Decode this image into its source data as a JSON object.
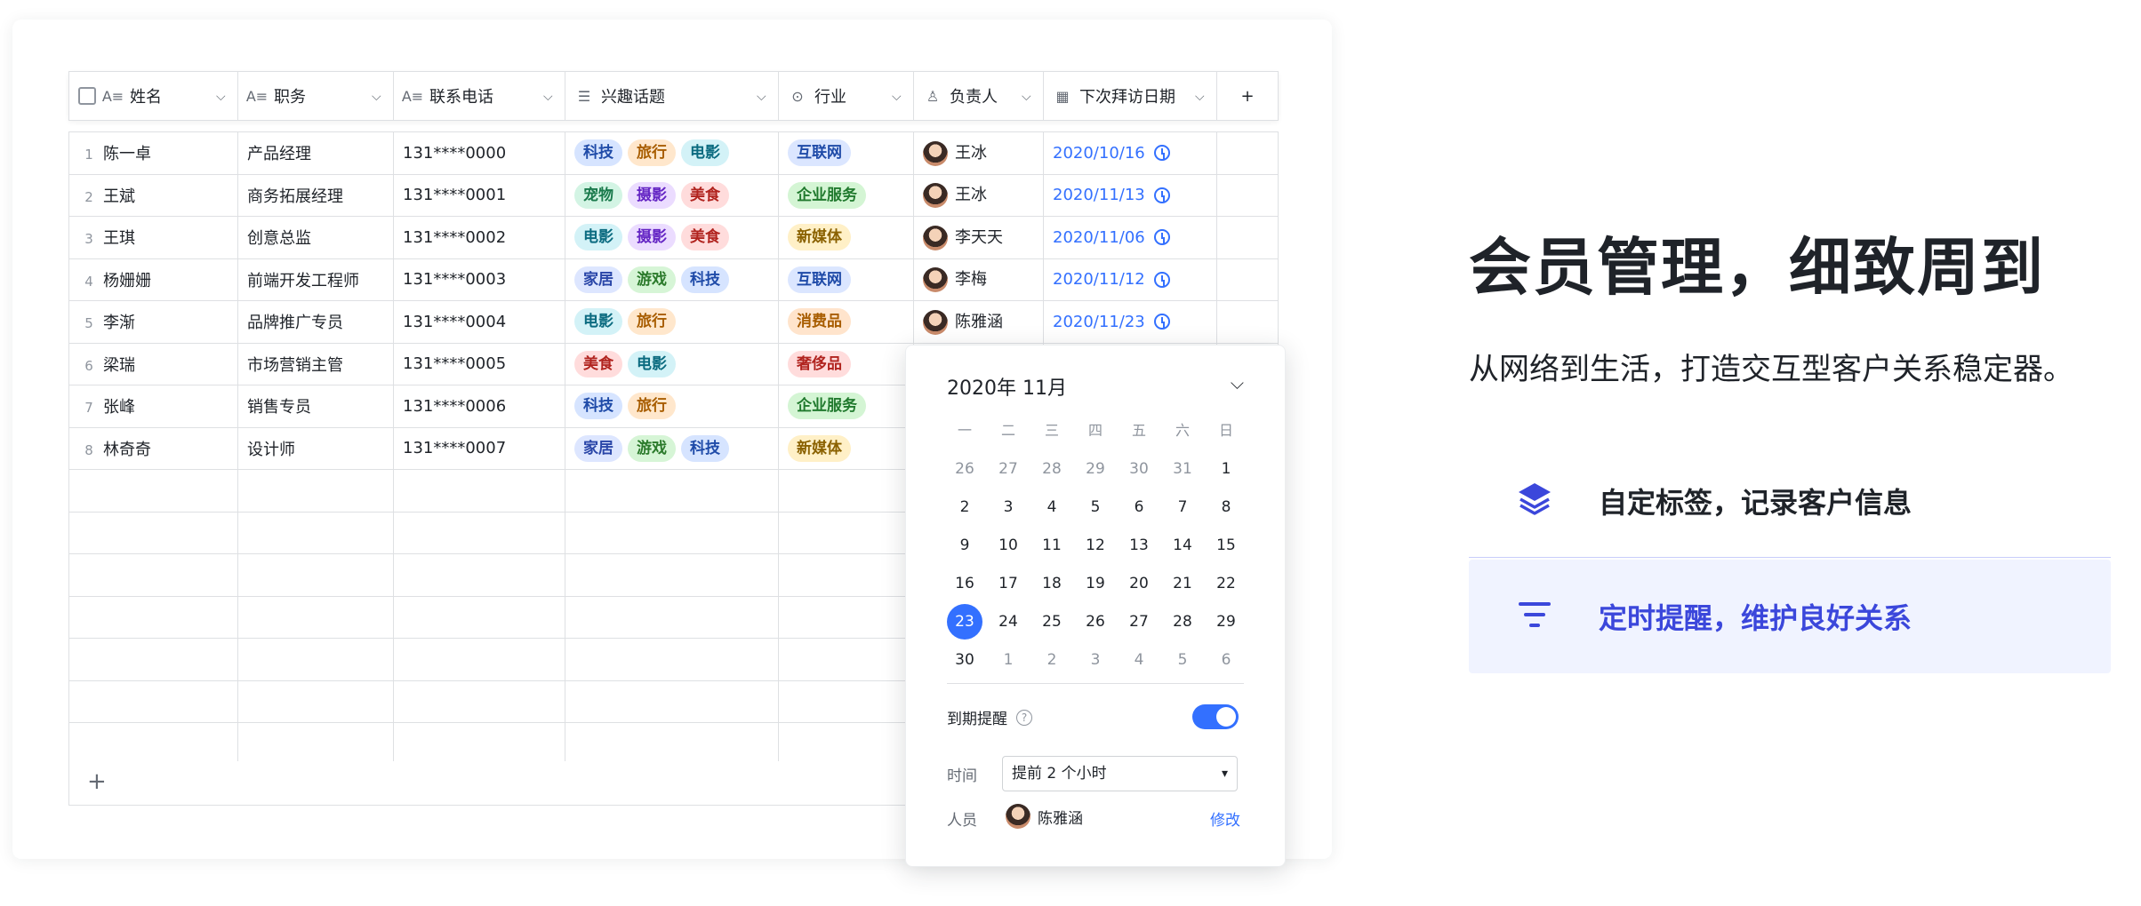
{
  "table": {
    "columns": [
      "姓名",
      "职务",
      "联系电话",
      "兴趣话题",
      "行业",
      "负责人",
      "下次拜访日期"
    ],
    "rows": [
      {
        "idx": "1",
        "name": "陈一卓",
        "title": "产品经理",
        "phone": "131****0000",
        "tags": [
          "科技",
          "旅行",
          "电影"
        ],
        "industry": "互联网",
        "owner": "王冰",
        "date": "2020/10/16"
      },
      {
        "idx": "2",
        "name": "王斌",
        "title": "商务拓展经理",
        "phone": "131****0001",
        "tags": [
          "宠物",
          "摄影",
          "美食"
        ],
        "industry": "企业服务",
        "owner": "王冰",
        "date": "2020/11/13"
      },
      {
        "idx": "3",
        "name": "王琪",
        "title": "创意总监",
        "phone": "131****0002",
        "tags": [
          "电影",
          "摄影",
          "美食"
        ],
        "industry": "新媒体",
        "owner": "李天天",
        "date": "2020/11/06"
      },
      {
        "idx": "4",
        "name": "杨姗姗",
        "title": "前端开发工程师",
        "phone": "131****0003",
        "tags": [
          "家居",
          "游戏",
          "科技"
        ],
        "industry": "互联网",
        "owner": "李梅",
        "date": "2020/11/12"
      },
      {
        "idx": "5",
        "name": "李渐",
        "title": "品牌推广专员",
        "phone": "131****0004",
        "tags": [
          "电影",
          "旅行"
        ],
        "industry": "消费品",
        "owner": "陈雅涵",
        "date": "2020/11/23"
      },
      {
        "idx": "6",
        "name": "梁瑞",
        "title": "市场营销主管",
        "phone": "131****0005",
        "tags": [
          "美食",
          "电影"
        ],
        "industry": "奢侈品",
        "owner": "",
        "date": ""
      },
      {
        "idx": "7",
        "name": "张峰",
        "title": "销售专员",
        "phone": "131****0006",
        "tags": [
          "科技",
          "旅行"
        ],
        "industry": "企业服务",
        "owner": "",
        "date": ""
      },
      {
        "idx": "8",
        "name": "林奇奇",
        "title": "设计师",
        "phone": "131****0007",
        "tags": [
          "家居",
          "游戏",
          "科技"
        ],
        "industry": "新媒体",
        "owner": "",
        "date": ""
      }
    ],
    "add_row": "+"
  },
  "tag_colors": {
    "科技": [
      "#d6e4ff",
      "#1f4ba8"
    ],
    "旅行": [
      "#ffe7cc",
      "#a85d00"
    ],
    "电影": [
      "#d3f2f7",
      "#0b6b80"
    ],
    "宠物": [
      "#d3f4e4",
      "#1a7a4c"
    ],
    "摄影": [
      "#ebdcff",
      "#6425c4"
    ],
    "美食": [
      "#ffdcdc",
      "#b1241f"
    ],
    "家居": [
      "#dde6ff",
      "#2a46a8"
    ],
    "游戏": [
      "#d6f5d6",
      "#2b7a2b"
    ],
    "互联网": [
      "#dbe6ff",
      "#1f4ba8"
    ],
    "企业服务": [
      "#d4f5d4",
      "#217a2e"
    ],
    "新媒体": [
      "#fff0c7",
      "#8a6100"
    ],
    "消费品": [
      "#ffe4cc",
      "#a85d00"
    ],
    "奢侈品": [
      "#ffdcdc",
      "#b1241f"
    ]
  },
  "datepicker": {
    "title": "2020年 11月",
    "weekdays": [
      "一",
      "二",
      "三",
      "四",
      "五",
      "六",
      "日"
    ],
    "weeks": [
      [
        "26",
        "27",
        "28",
        "29",
        "30",
        "31",
        "1"
      ],
      [
        "2",
        "3",
        "4",
        "5",
        "6",
        "7",
        "8"
      ],
      [
        "9",
        "10",
        "11",
        "12",
        "13",
        "14",
        "15"
      ],
      [
        "16",
        "17",
        "18",
        "19",
        "20",
        "21",
        "22"
      ],
      [
        "23",
        "24",
        "25",
        "26",
        "27",
        "28",
        "29"
      ],
      [
        "30",
        "1",
        "2",
        "3",
        "4",
        "5",
        "6"
      ]
    ],
    "selected": "23",
    "remind_label": "到期提醒",
    "remind_on": true,
    "time_label": "时间",
    "time_value": "提前 2 个小时",
    "person_label": "人员",
    "person_value": "陈雅涵",
    "modify_label": "修改"
  },
  "hero": {
    "title": "会员管理，细致周到",
    "subtitle": "从网络到生活，打造交互型客户关系稳定器。",
    "features": [
      {
        "label": "自定标签，记录客户信息",
        "icon": "layers-icon"
      },
      {
        "label": "定时提醒，维护良好关系",
        "icon": "filter-lines-icon"
      }
    ]
  },
  "accent": "#3370ff"
}
